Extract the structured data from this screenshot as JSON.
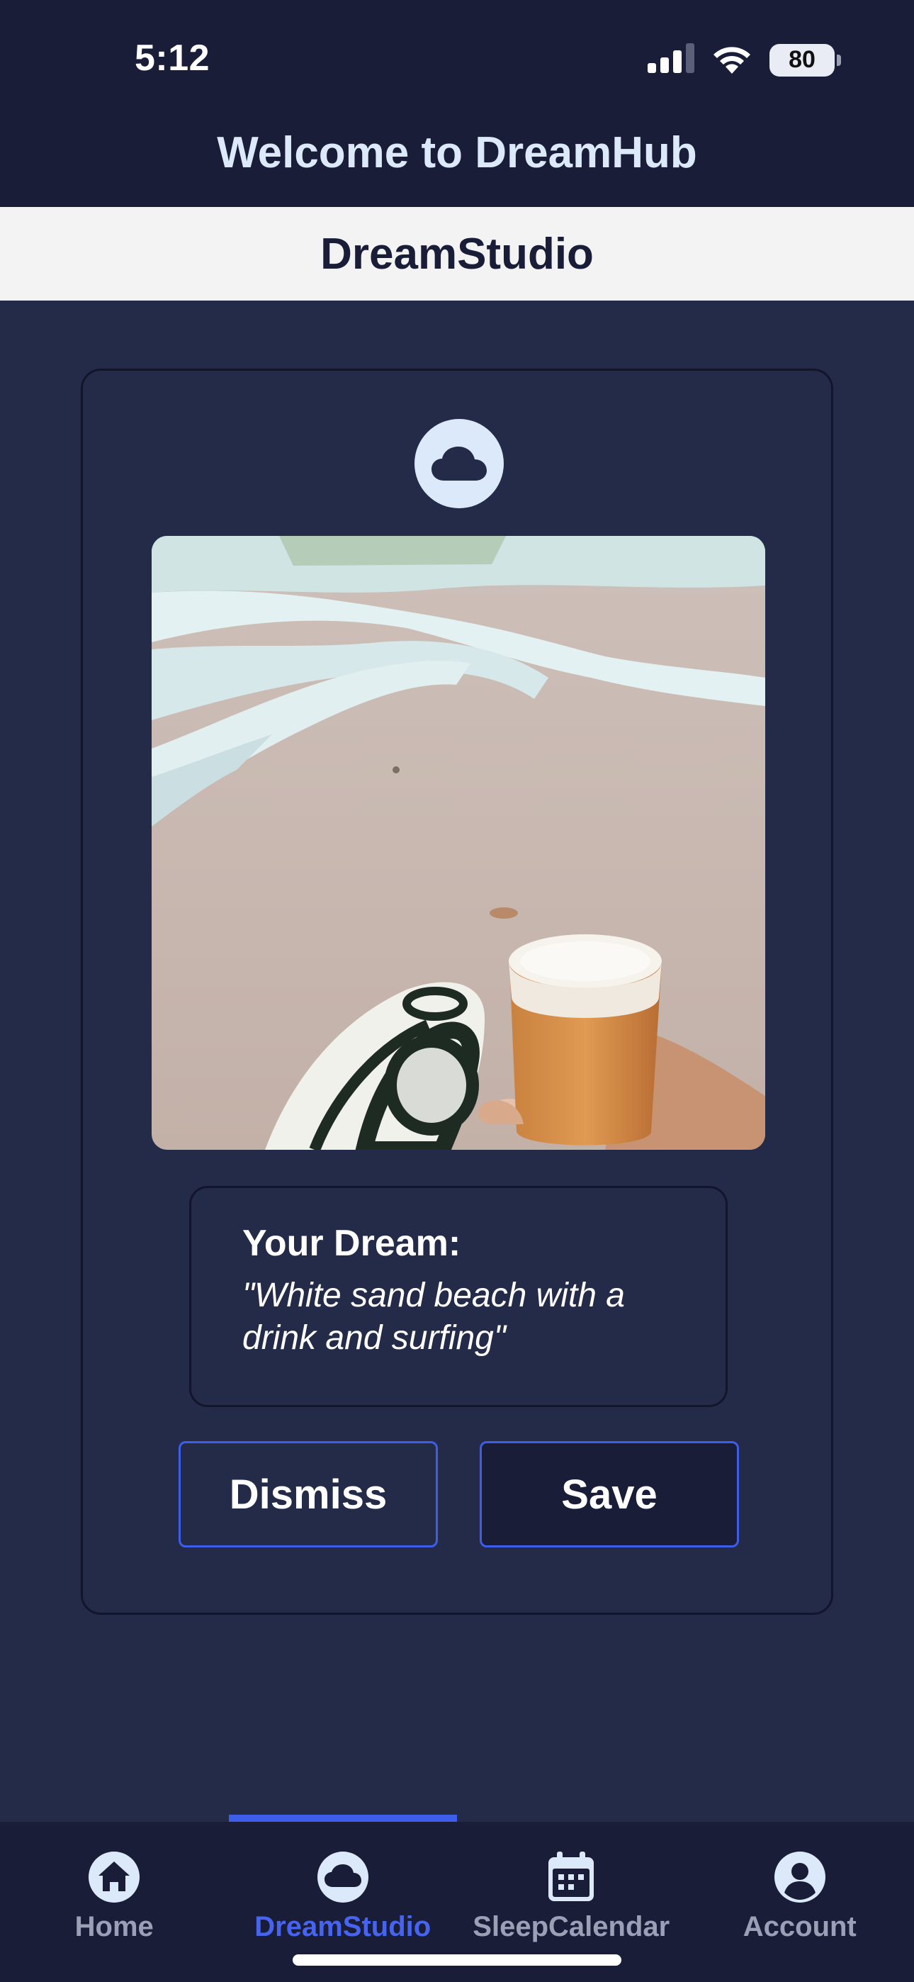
{
  "status_bar": {
    "time": "5:12",
    "battery": "80"
  },
  "header": {
    "title": "Welcome to DreamHub"
  },
  "sub_header": {
    "title": "DreamStudio"
  },
  "dream_card": {
    "icon": "cloud-icon",
    "image_alt": "Beach scene with a surfboard and a glass of beer",
    "dream_label": "Your Dream:",
    "dream_text": "\"White sand beach with a drink and surfing\"",
    "dismiss_label": "Dismiss",
    "save_label": "Save"
  },
  "bottom_nav": {
    "items": [
      {
        "label": "Home",
        "icon": "home-icon"
      },
      {
        "label": "DreamStudio",
        "icon": "cloud-icon",
        "active": true
      },
      {
        "label": "SleepCalendar",
        "icon": "calendar-icon"
      },
      {
        "label": "Account",
        "icon": "account-icon"
      }
    ]
  },
  "colors": {
    "header_bg": "#1a1d38",
    "page_bg": "#242b49",
    "accent": "#3e5de8",
    "header_text": "#dce9fb"
  }
}
